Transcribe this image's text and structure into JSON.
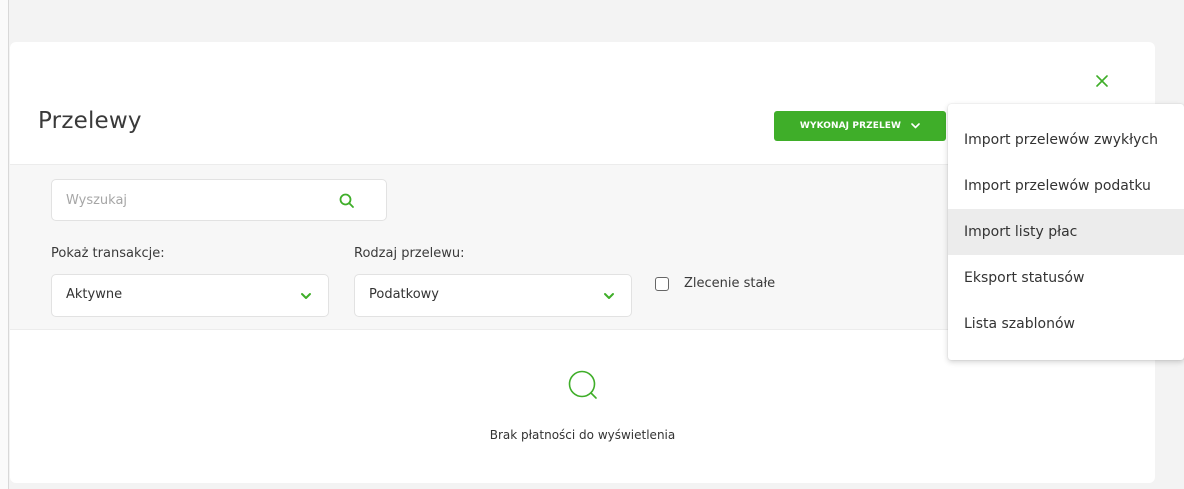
{
  "header": {
    "title": "Przelewy",
    "primary_button_label": "WYKONAJ PRZELEW",
    "close_label": "×"
  },
  "search": {
    "placeholder": "Wyszukaj",
    "value": ""
  },
  "filters": {
    "show_transactions": {
      "label": "Pokaż transakcje:",
      "value": "Aktywne"
    },
    "transfer_type": {
      "label": "Rodzaj przelewu:",
      "value": "Podatkowy"
    },
    "standing_order": {
      "label": "Zlecenie stałe",
      "checked": false
    }
  },
  "empty_state": {
    "text": "Brak płatności do wyświetlenia"
  },
  "dropdown": {
    "items": [
      {
        "label": "Import przelewów zwykłych"
      },
      {
        "label": "Import przelewów podatku"
      },
      {
        "label": "Import listy płac"
      },
      {
        "label": "Eksport statusów"
      },
      {
        "label": "Lista szablonów"
      }
    ],
    "highlighted_item": "Import listy płac"
  },
  "colors": {
    "accent": "#3fae29",
    "background": "#f3f3f3",
    "card": "#ffffff",
    "filter_panel": "#f7f7f7",
    "hover": "#ececec"
  },
  "icons": {
    "close": "close-icon",
    "primary_chevron": "chevron-down-icon",
    "search": "search-icon",
    "select_chevron": "chevron-down-icon",
    "empty_state": "search-icon"
  }
}
